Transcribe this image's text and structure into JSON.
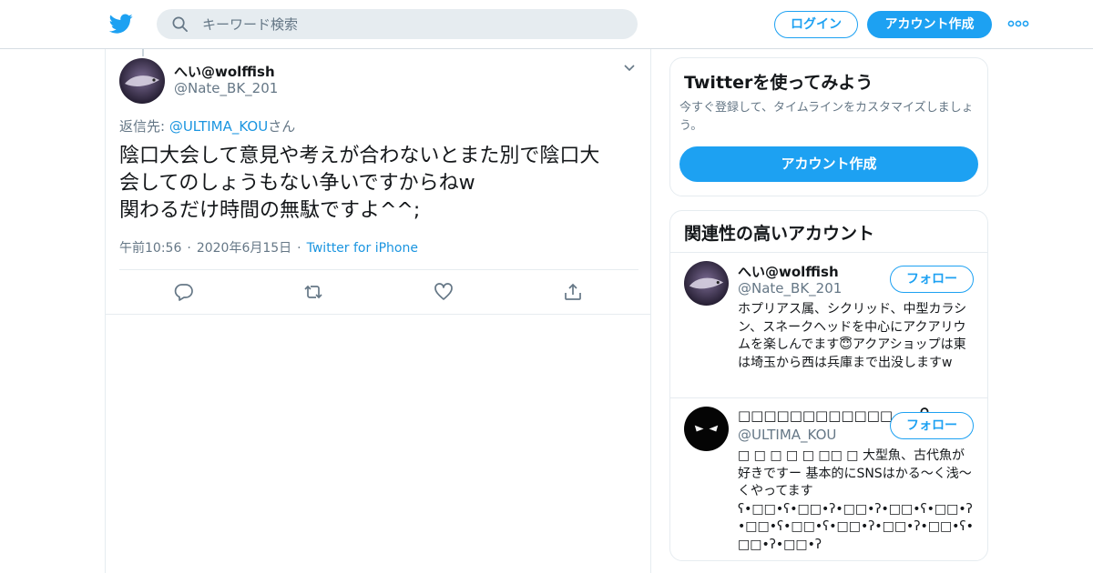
{
  "header": {
    "search_placeholder": "キーワード検索",
    "login_label": "ログイン",
    "signup_label": "アカウント作成",
    "brand_color": "#1da1f2"
  },
  "tweet": {
    "display_name": "へい@wolffish",
    "handle": "@Nate_BK_201",
    "reply_prefix": "返信先: ",
    "reply_mention": "@ULTIMA_KOU",
    "reply_suffix": "さん",
    "text_lines": [
      "陰口大会して意見や考えが合わないとまた別で陰口大",
      "会してのしょうもない争いですからねw",
      "関わるだけ時間の無駄ですよ^^;"
    ],
    "time": "午前10:56",
    "date": "2020年6月15日",
    "source": "Twitter for iPhone",
    "dot": "·"
  },
  "sidebar": {
    "signup_card": {
      "title": "Twitterを使ってみよう",
      "description": "今すぐ登録して、タイムラインをカスタマイズしましょう。",
      "button": "アカウント作成"
    },
    "related": {
      "title": "関連性の高いアカウント",
      "accounts": [
        {
          "name": "へい@wolffish",
          "handle": "@Nate_BK_201",
          "follow_label": "フォロー",
          "bio": "ホプリアス属、シクリッド、中型カラシン、スネークヘッドを中心にアクアリウムを楽しんでます😇アクアショップは東は埼玉から西は兵庫まで出没しますw"
        },
        {
          "name": "□□□□□□□□□□□□...",
          "handle": "@ULTIMA_KOU",
          "follow_label": "フォロー",
          "bio_line1": "□ □ □ □ □ □□ □ 大型魚、古代魚が好きですー 基本的にSNSはかる〜く浅〜くやってます",
          "bio_line2": "ʕ•□□•ʕ•□□•ʔ•□□•ʔ•□□•ʕ•□□•ʔ•□□•ʕ•□□•ʕ•□□•ʔ•□□•ʔ•□□•ʕ•□□•ʔ•□□•ʔ"
        }
      ]
    }
  }
}
